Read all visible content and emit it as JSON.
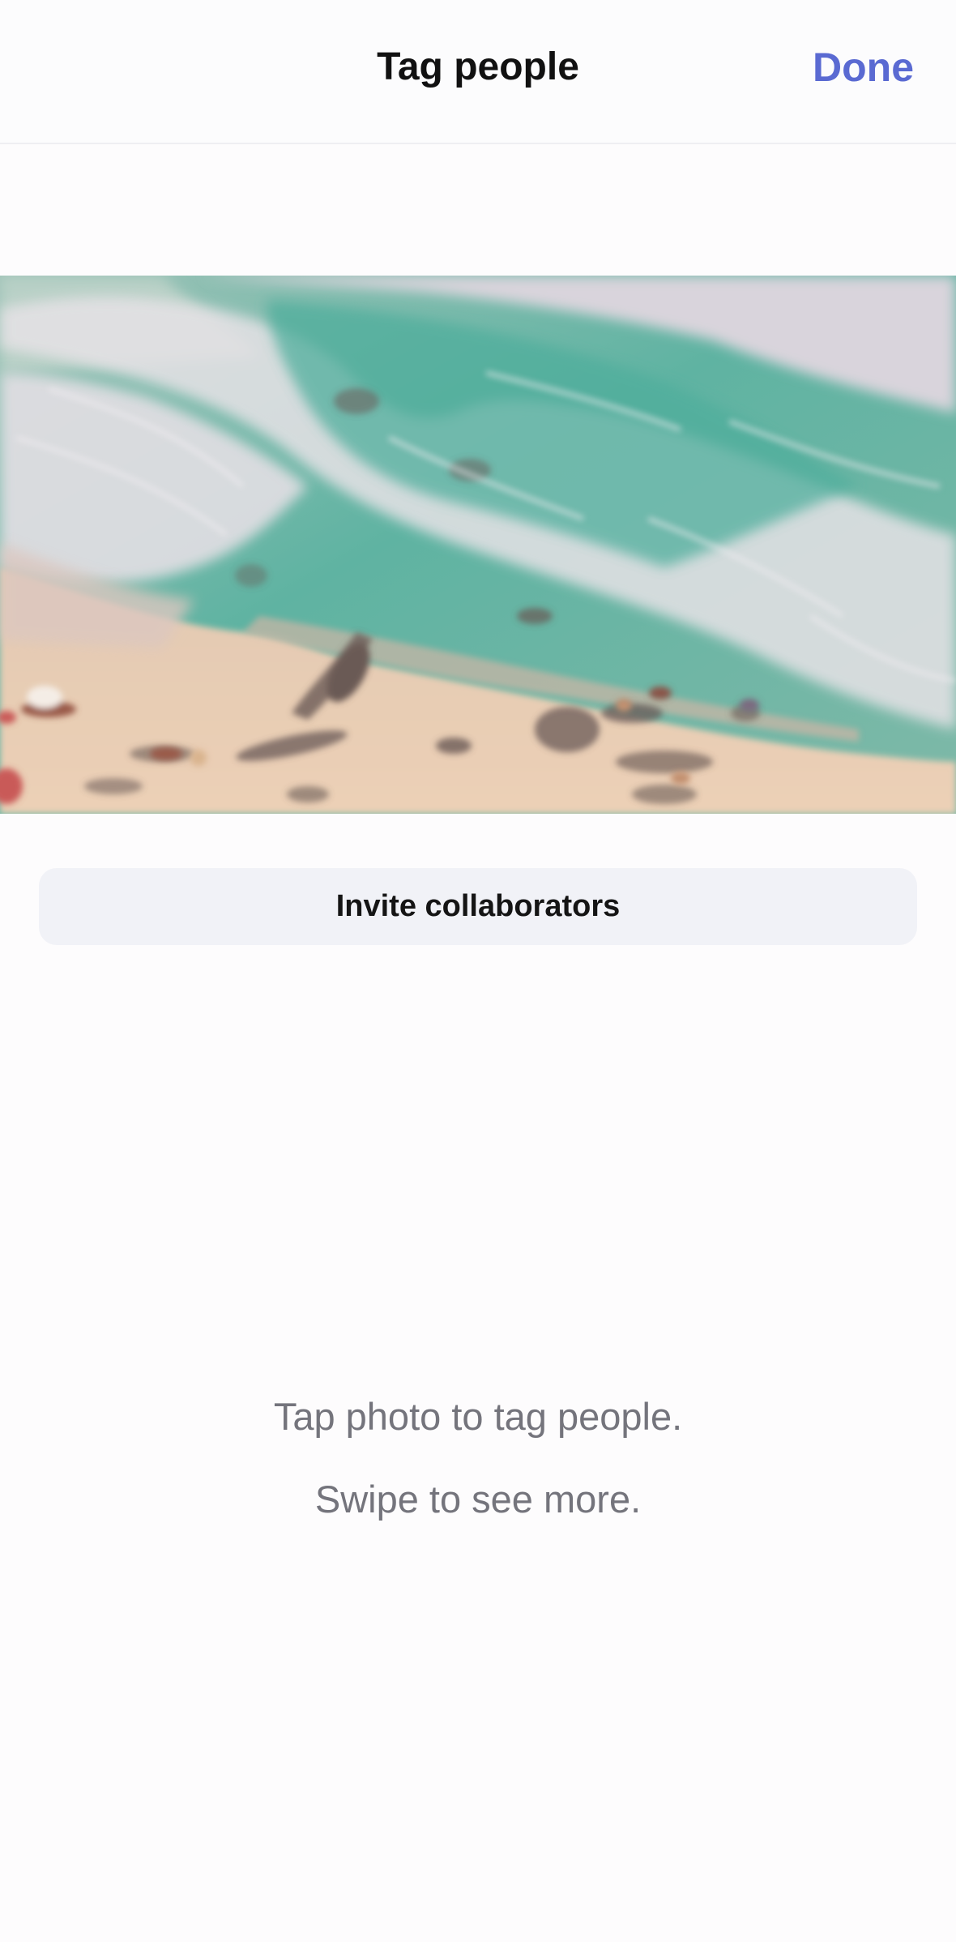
{
  "header": {
    "title": "Tag people",
    "done_label": "Done"
  },
  "photo": {
    "subject": "aerial beach photo",
    "palette": {
      "sea": "#5fb3a2",
      "foam": "#e6e2e6",
      "sand": "#e8cdb4",
      "shadow": "#6a5a55"
    }
  },
  "actions": {
    "invite_label": "Invite collaborators"
  },
  "hints": {
    "line1": "Tap photo to tag people.",
    "line2": "Swipe to see more."
  },
  "colors": {
    "accent": "#5a6ad2",
    "background": "#fdfcfd",
    "button_bg": "#f1f2f7",
    "hint_text": "#74747c"
  }
}
